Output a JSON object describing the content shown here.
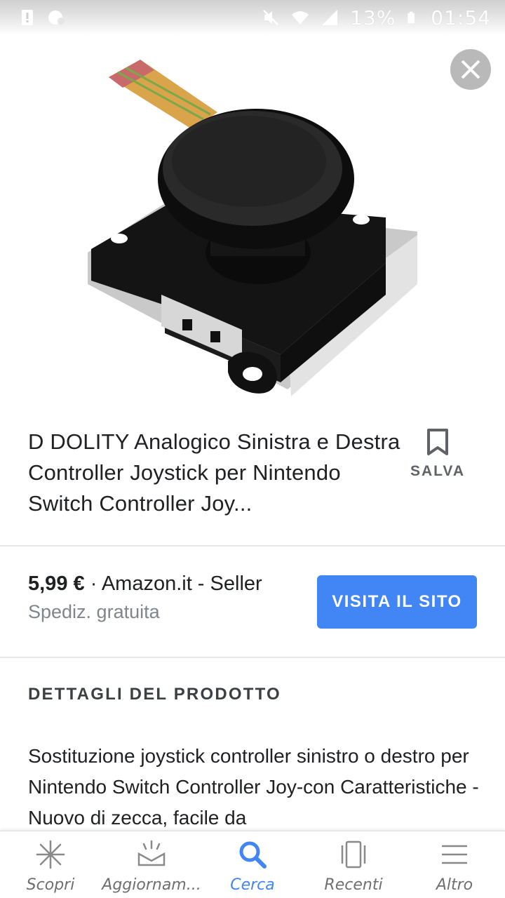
{
  "status_bar": {
    "battery": "13%",
    "time": "01:54"
  },
  "icons": {
    "close": "close-icon",
    "save": "bookmark-icon",
    "nav": [
      "discover-icon",
      "updates-icon",
      "search-icon",
      "recent-icon",
      "menu-icon"
    ]
  },
  "colors": {
    "accent": "#4285f4",
    "text_primary": "#202124",
    "text_secondary": "#80868b"
  },
  "product": {
    "title": "D DOLITY Analogico Sinistra e Destra Controller Joystick per Nintendo Switch Controller Joy...",
    "save_label": "SALVA",
    "price": "5,99 €",
    "separator": " · ",
    "seller": "Amazon.it - Seller",
    "shipping": "Spediz. gratuita",
    "visit_label": "VISITA IL SITO"
  },
  "details": {
    "heading": "DETTAGLI DEL PRODOTTO",
    "text": "Sostituzione joystick controller sinistro o destro per Nintendo Switch Controller Joy-con Caratteristiche - Nuovo di zecca, facile da"
  },
  "bottom_nav": {
    "items": [
      {
        "label": "Scopri",
        "active": false
      },
      {
        "label": "Aggiornam...",
        "active": false
      },
      {
        "label": "Cerca",
        "active": true
      },
      {
        "label": "Recenti",
        "active": false
      },
      {
        "label": "Altro",
        "active": false
      }
    ]
  }
}
